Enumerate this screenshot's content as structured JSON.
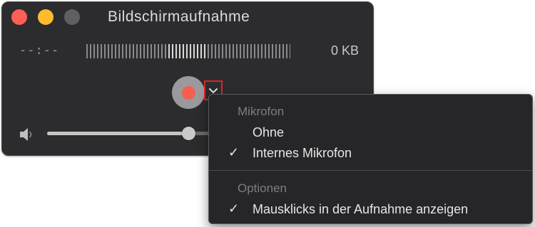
{
  "window": {
    "title": "Bildschirmaufnahme",
    "time_display": "--:--",
    "file_size": "0 KB",
    "volume_level": 0.66
  },
  "menu": {
    "microphone_section": "Mikrofon",
    "microphone_items": [
      {
        "label": "Ohne",
        "checked": false
      },
      {
        "label": "Internes Mikrofon",
        "checked": true
      }
    ],
    "options_section": "Optionen",
    "options_items": [
      {
        "label": "Mausklicks in der Aufnahme anzeigen",
        "checked": true
      }
    ],
    "check_glyph": "✓"
  },
  "colors": {
    "close": "#fe5f57",
    "minimize": "#febc2e",
    "zoom": "#5f5f62",
    "record_dot": "#f55f50",
    "highlight_border": "#d9262b"
  },
  "icons": [
    "record-icon",
    "chevron-down-icon",
    "speaker-icon",
    "checkmark-icon"
  ]
}
